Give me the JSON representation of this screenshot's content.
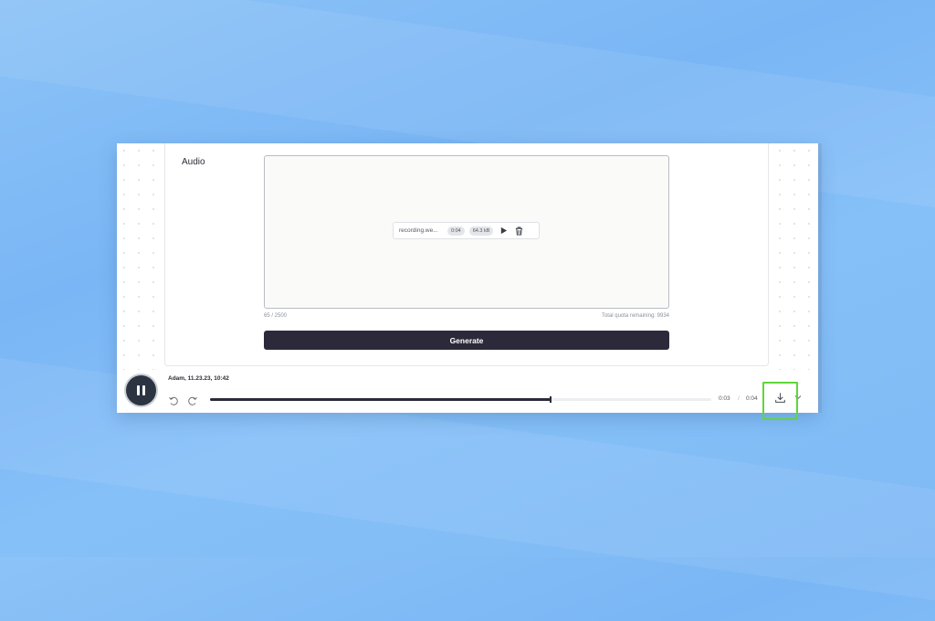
{
  "audio_section": {
    "label": "Audio",
    "file": {
      "name": "recording.we...",
      "duration": "0:04",
      "size": "64.3 kB",
      "play_icon": "play-icon",
      "delete_icon": "trash-icon"
    },
    "counter": "65 / 2500",
    "quota": "Total quota remaining: 9934",
    "generate_label": "Generate"
  },
  "player": {
    "title": "Adam, 11.23.23, 10:42",
    "state_icon": "pause-icon",
    "current_time": "0:03",
    "separator": "/",
    "total_time": "0:04",
    "progress": 0.68,
    "rewind_icon": "rewind-icon",
    "forward_icon": "forward-icon",
    "download_icon": "download-icon",
    "more_icon": "chevron-down-icon"
  },
  "colors": {
    "button_dark": "#2c2a3a",
    "highlight": "#5fd63a",
    "background": "#7ab6f5"
  }
}
